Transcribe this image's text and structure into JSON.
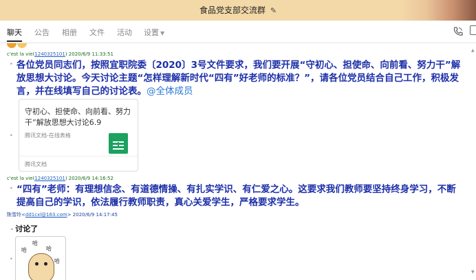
{
  "window": {
    "title": "食品党支部交流群",
    "edit_icon": "✎"
  },
  "tabs": [
    {
      "label": "聊天",
      "active": true
    },
    {
      "label": "公告"
    },
    {
      "label": "相册"
    },
    {
      "label": "文件"
    },
    {
      "label": "活动"
    },
    {
      "label": "设置"
    }
  ],
  "toolbar": {
    "phone_icon": "phone-icon",
    "more_icon": "panel-icon"
  },
  "messages": [
    {
      "sender_name": "c'est la vie(",
      "sender_id": "1240325101",
      "sender_close": ")",
      "time": "2020/6/9 11:33:51",
      "text": "各位党员同志们，按照宜职院委〔2020〕3号文件要求，我们要开展“守初心、担使命、向前看、努力干”解放思想大讨论。今天讨论主题“怎样理解新时代“四有”好老师的标准？”，请各位党员结合自己工作，积极发言，并在线填写自己的讨论表。",
      "mention": "@全体成员",
      "card": {
        "title": "守初心、担使命、向前看、努力干”解放思想大讨论6.9",
        "subtitle": "腾讯文档-在线表格",
        "footer": "腾讯文档"
      }
    },
    {
      "sender_name": "c'est la vie(",
      "sender_id": "1240325101",
      "sender_close": ")",
      "time": "2020/6/9 14:16:52",
      "text": "“四有”老师：有理想信念、有道德情操、有扎实学识、有仁爱之心。这要求我们教师要坚持终身学习，不断提高自己的学识，依法履行教师职责，真心关爱学生，严格要求学生。"
    },
    {
      "sender_name": "陈雪玲<",
      "sender_id": "dd1cxl@163.com",
      "sender_close": ">",
      "time": "2020/6/9 14:17:45",
      "text": "讨论了",
      "sticker_text": "哈"
    }
  ],
  "colors": {
    "message_text": "#1c2fa8",
    "sender_green": "#1a6d1a",
    "link": "#1f5fbf",
    "mention": "#2b7ad8",
    "sheet_green": "#1ba25f",
    "titlebar": "#f4d9a8"
  }
}
